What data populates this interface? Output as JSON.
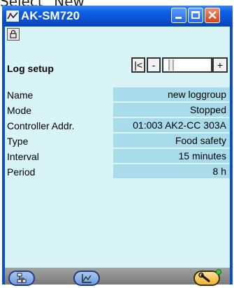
{
  "caption": "Select \"New\"",
  "window": {
    "title": "AK-SM720"
  },
  "log_setup": {
    "title": "Log setup",
    "nav": {
      "first": "|<",
      "prev": "-",
      "next": "+"
    }
  },
  "fields": [
    {
      "label": "Name",
      "value": "new loggroup"
    },
    {
      "label": "Mode",
      "value": "Stopped"
    },
    {
      "label": "Controller Addr.",
      "value": "01:003 AK2-CC 303A"
    },
    {
      "label": "Type",
      "value": "Food safety"
    },
    {
      "label": "Interval",
      "value": "15 minutes"
    },
    {
      "label": "Period",
      "value": "8 h"
    }
  ],
  "colors": {
    "titlebar": "#0a4fd0",
    "client_bg": "#d9f4f6",
    "value_bg": "#a9dcea",
    "status_dot": "#3ec43a"
  },
  "icons": {
    "app": "network-icon",
    "lock": "lock-icon",
    "tree": "tree-icon",
    "log": "log-chart-icon",
    "active_tool": "wrench-icon",
    "status": "status-dot"
  }
}
